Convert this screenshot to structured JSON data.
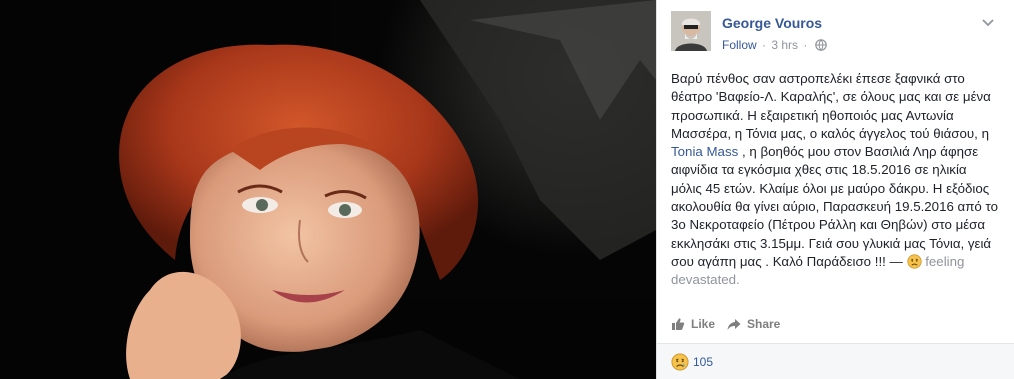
{
  "post": {
    "author": "George Vouros",
    "follow_label": "Follow",
    "separator": "·",
    "time": "3 hrs",
    "text": {
      "p1": "Βαρύ πένθος σαν αστροπελέκι έπεσε ξαφνικά στο θέατρο 'Βαφείο-Λ. Καραλής', σε όλους μας και σε μένα προσωπικά. Η εξαιρετική ηθοποιός μας Αντωνία Μασσέρα, η Τόνια μας, ο καλός άγγελος τού θιάσου, η ",
      "tag": "Tonia Mass",
      "p2": " , η βοηθός μου στον Βασιλιά Ληρ άφησε αιφνίδια τα εγκόσμια χθες στις 18.5.2016 σε ηλικία μόλις 45 ετών. Κλαίμε όλοι με μαύρο δάκρυ. Η εξόδιος ακολουθία θα γίνει αύριο, Παρασκευή 19.5.2016 από το 3ο Νεκροταφείο (Πέτρου Ράλλη και Θηβών) στο μέσα εκκλησάκι στις 3.15μμ. Γειά σου γλυκιά μας Τόνια, γειά σου αγάπη μας . Καλό Παράδεισο !!! — ",
      "feeling": "feeling devastated."
    }
  },
  "actions": {
    "like_label": "Like",
    "share_label": "Share"
  },
  "reactions": {
    "count": "105"
  },
  "icons": {
    "globe": "globe-icon",
    "chevron": "chevron-down-icon",
    "like": "thumbs-up-icon",
    "share": "share-arrow-icon",
    "sad": "sad-face-icon"
  },
  "colors": {
    "link": "#365899",
    "muted": "#90949c",
    "text": "#1d2129",
    "photo_bg": "#040404",
    "hair": "#b13a1c",
    "emoji": "#f7c34a"
  }
}
